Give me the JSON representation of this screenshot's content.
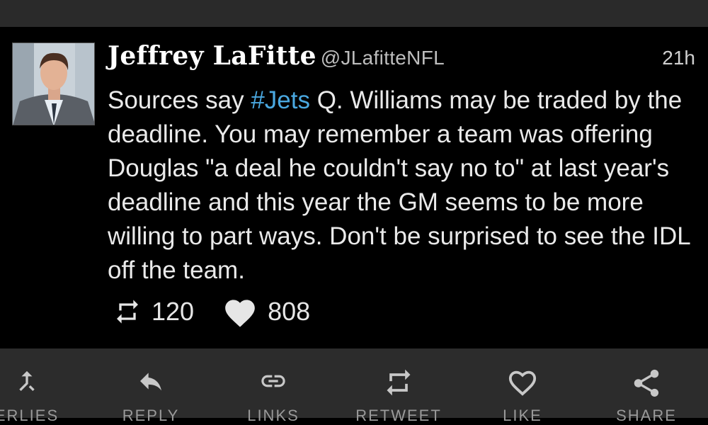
{
  "tweet": {
    "author_name": "Jeffrey LaFitte",
    "handle": "@JLafitteNFL",
    "time": "21h",
    "text_before": "Sources say ",
    "hashtag": "#Jets",
    "text_after": " Q. Williams may be traded by the deadline. You may remember a team was offering Douglas \"a deal he couldn't say no to\" at last year's deadline and this year the GM seems to be more willing to part ways. Don't be surprised to see the IDL off the team.",
    "retweet_count": "120",
    "like_count": "808",
    "hashtag_color": "#4aa8e0"
  },
  "actions": [
    {
      "label": "ERLIES",
      "icon": "merge-arrow-icon"
    },
    {
      "label": "REPLY",
      "icon": "reply-icon"
    },
    {
      "label": "LINKS",
      "icon": "link-icon"
    },
    {
      "label": "RETWEET",
      "icon": "retweet-icon"
    },
    {
      "label": "LIKE",
      "icon": "heart-outline-icon"
    },
    {
      "label": "SHARE",
      "icon": "share-icon"
    }
  ]
}
